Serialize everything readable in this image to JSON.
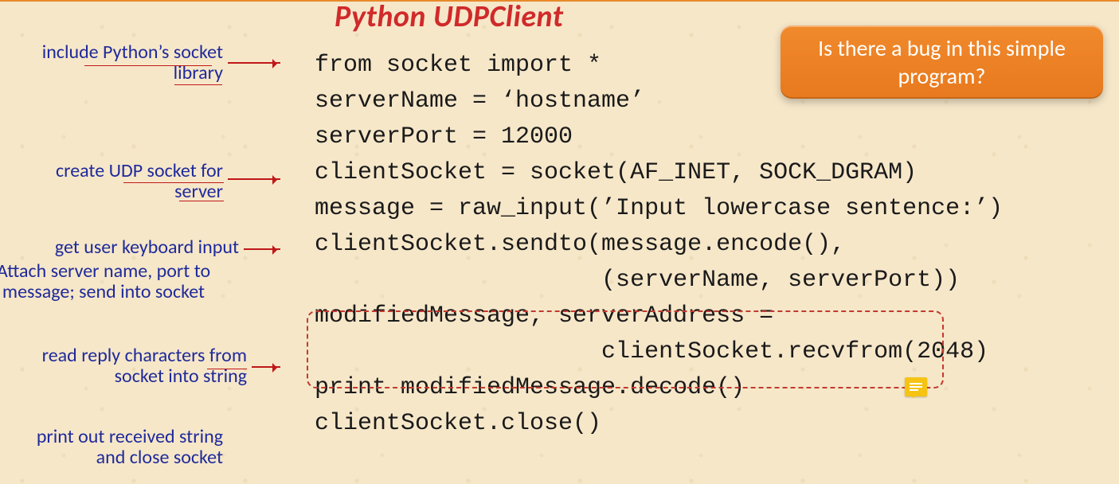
{
  "title": "Python UDPClient",
  "callout": "Is there a bug in this simple program?",
  "code": {
    "l1": "from socket import *",
    "l2": "serverName = ‘hostname’",
    "l3": "serverPort = 12000",
    "l4": "clientSocket = socket(AF_INET, SOCK_DGRAM)",
    "l5": "message = raw_input(’Input lowercase sentence:’)",
    "l6": "clientSocket.sendto(message.encode(),",
    "l7": "                    (serverName, serverPort))",
    "l8": "modifiedMessage, serverAddress =",
    "l9": "                    clientSocket.recvfrom(2048)",
    "l10": "print modifiedMessage.decode()",
    "l11": "clientSocket.close()"
  },
  "annotations": {
    "a1": "include Python’s socket\nlibrary",
    "a2": "create UDP socket for\nserver",
    "a3": "get user keyboard input",
    "a4": "Attach server name, port to\nmessage; send into socket",
    "a5": "read reply characters from\nsocket into string",
    "a6": "print out received string\nand close socket"
  },
  "icons": {
    "comment": "comment-icon"
  }
}
